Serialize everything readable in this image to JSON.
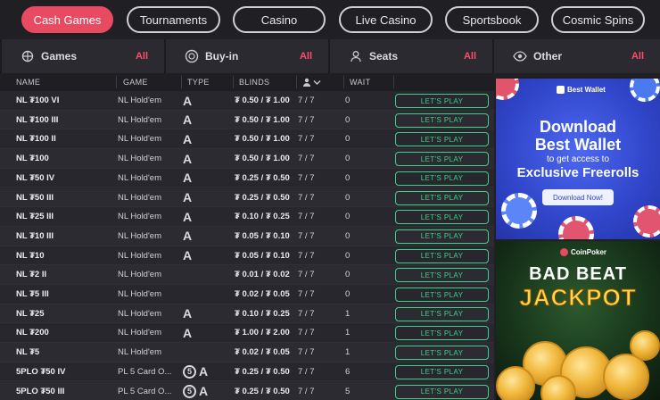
{
  "nav": {
    "tabs": [
      {
        "label": "Cash Games",
        "active": true
      },
      {
        "label": "Tournaments",
        "active": false
      },
      {
        "label": "Casino",
        "active": false
      },
      {
        "label": "Live Casino",
        "active": false
      },
      {
        "label": "Sportsbook",
        "active": false
      },
      {
        "label": "Cosmic Spins",
        "active": false
      }
    ]
  },
  "filters": [
    {
      "label": "Games",
      "value": "All",
      "icon": "games-icon"
    },
    {
      "label": "Buy-in",
      "value": "All",
      "icon": "chip-icon"
    },
    {
      "label": "Seats",
      "value": "All",
      "icon": "user-icon"
    },
    {
      "label": "Other",
      "value": "All",
      "icon": "eye-icon"
    }
  ],
  "table": {
    "headers": {
      "name": "NAME",
      "game": "GAME",
      "type": "TYPE",
      "blinds": "BLINDS",
      "wait": "WAIT"
    },
    "play_label": "LET'S PLAY",
    "rows": [
      {
        "name": "NL ₮100 VI",
        "game": "NL  Hold'em",
        "type": "A",
        "five": false,
        "blinds": "₮ 0.50 / ₮ 1.00",
        "seats": "7 / 7",
        "wait": "0"
      },
      {
        "name": "NL ₮100 III",
        "game": "NL  Hold'em",
        "type": "A",
        "five": false,
        "blinds": "₮ 0.50 / ₮ 1.00",
        "seats": "7 / 7",
        "wait": "0"
      },
      {
        "name": "NL ₮100 II",
        "game": "NL  Hold'em",
        "type": "A",
        "five": false,
        "blinds": "₮ 0.50 / ₮ 1.00",
        "seats": "7 / 7",
        "wait": "0"
      },
      {
        "name": "NL ₮100",
        "game": "NL  Hold'em",
        "type": "A",
        "five": false,
        "blinds": "₮ 0.50 / ₮ 1.00",
        "seats": "7 / 7",
        "wait": "0"
      },
      {
        "name": "NL ₮50 IV",
        "game": "NL  Hold'em",
        "type": "A",
        "five": false,
        "blinds": "₮ 0.25 / ₮ 0.50",
        "seats": "7 / 7",
        "wait": "0"
      },
      {
        "name": "NL ₮50 III",
        "game": "NL  Hold'em",
        "type": "A",
        "five": false,
        "blinds": "₮ 0.25 / ₮ 0.50",
        "seats": "7 / 7",
        "wait": "0"
      },
      {
        "name": "NL ₮25 III",
        "game": "NL  Hold'em",
        "type": "A",
        "five": false,
        "blinds": "₮ 0.10 / ₮ 0.25",
        "seats": "7 / 7",
        "wait": "0"
      },
      {
        "name": "NL ₮10 III",
        "game": "NL  Hold'em",
        "type": "A",
        "five": false,
        "blinds": "₮ 0.05 / ₮ 0.10",
        "seats": "7 / 7",
        "wait": "0"
      },
      {
        "name": "NL ₮10",
        "game": "NL  Hold'em",
        "type": "A",
        "five": false,
        "blinds": "₮ 0.05 / ₮ 0.10",
        "seats": "7 / 7",
        "wait": "0"
      },
      {
        "name": "NL ₮2 II",
        "game": "NL  Hold'em",
        "type": "",
        "five": false,
        "blinds": "₮ 0.01 / ₮ 0.02",
        "seats": "7 / 7",
        "wait": "0"
      },
      {
        "name": "NL ₮5 III",
        "game": "NL  Hold'em",
        "type": "",
        "five": false,
        "blinds": "₮ 0.02 / ₮ 0.05",
        "seats": "7 / 7",
        "wait": "0"
      },
      {
        "name": "NL ₮25",
        "game": "NL  Hold'em",
        "type": "A",
        "five": false,
        "blinds": "₮ 0.10 / ₮ 0.25",
        "seats": "7 / 7",
        "wait": "1"
      },
      {
        "name": "NL ₮200",
        "game": "NL  Hold'em",
        "type": "A",
        "five": false,
        "blinds": "₮ 1.00 / ₮ 2.00",
        "seats": "7 / 7",
        "wait": "1"
      },
      {
        "name": "NL ₮5",
        "game": "NL  Hold'em",
        "type": "",
        "five": false,
        "blinds": "₮ 0.02 / ₮ 0.05",
        "seats": "7 / 7",
        "wait": "1"
      },
      {
        "name": "5PLO ₮50 IV",
        "game": "PL  5 Card O...",
        "type": "A",
        "five": true,
        "blinds": "₮ 0.25 / ₮ 0.50",
        "seats": "7 / 7",
        "wait": "6"
      },
      {
        "name": "5PLO ₮50 III",
        "game": "PL  5 Card O...",
        "type": "A",
        "five": true,
        "blinds": "₮ 0.25 / ₮ 0.50",
        "seats": "7 / 7",
        "wait": "5"
      }
    ]
  },
  "ads": {
    "wallet": {
      "brand": "Best Wallet",
      "line1": "Download",
      "line2": "Best Wallet",
      "line3": "to get access to",
      "line4": "Exclusive Freerolls",
      "button": "Download Now!"
    },
    "jackpot": {
      "brand": "CoinPoker",
      "line1": "BAD BEAT",
      "line2": "JACKPOT"
    }
  },
  "colors": {
    "accent": "#e84a62",
    "play": "#3fd08b",
    "filter_value": "#ff4d6a"
  }
}
